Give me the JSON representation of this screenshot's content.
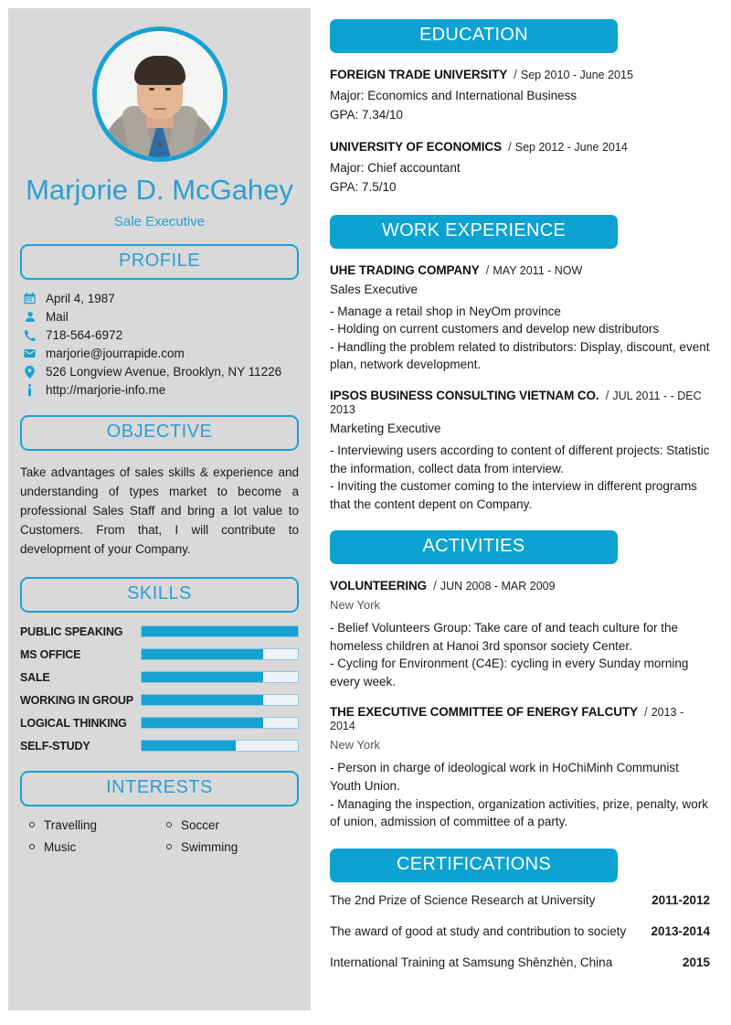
{
  "theme": {
    "accent": "#0ca3d2",
    "accent_border": "#17a2d4",
    "sidebar_bg": "#d9d9d9",
    "name_color": "#2b9ed4"
  },
  "sidebar": {
    "name": "Marjorie D. McGahey",
    "job_title": "Sale Executive",
    "profile_heading": "PROFILE",
    "contacts": [
      {
        "icon": "calendar-icon",
        "text": "April 4, 1987"
      },
      {
        "icon": "user-icon",
        "text": "Mail"
      },
      {
        "icon": "phone-icon",
        "text": "718-564-6972"
      },
      {
        "icon": "envelope-icon",
        "text": "marjorie@jourrapide.com"
      },
      {
        "icon": "map-pin-icon",
        "text": "526 Longview Avenue, Brooklyn, NY 11226"
      },
      {
        "icon": "info-icon",
        "text": "http://marjorie-info.me"
      }
    ],
    "objective_heading": "OBJECTIVE",
    "objective_text": "Take advantages of sales skills & experience and understanding of types market to become a professional Sales Staff and bring a lot value to Customers. From that, I will contribute to development of your Company.",
    "skills_heading": "SKILLS",
    "skills": [
      {
        "label": "PUBLIC SPEAKING",
        "value": 100
      },
      {
        "label": "MS OFFICE",
        "value": 78
      },
      {
        "label": "SALE",
        "value": 78
      },
      {
        "label": "WORKING IN GROUP",
        "value": 78
      },
      {
        "label": "LOGICAL THINKING",
        "value": 78
      },
      {
        "label": "SELF-STUDY",
        "value": 60
      }
    ],
    "interests_heading": "INTERESTS",
    "interests": [
      "Travelling",
      "Soccer",
      "Music",
      "Swimming"
    ]
  },
  "main": {
    "education": {
      "heading": "EDUCATION",
      "items": [
        {
          "org": "FOREIGN TRADE UNIVERSITY",
          "sep": "/",
          "date": "Sep 2010 - June 2015",
          "line1": "Major: Economics and International Business",
          "line2": "GPA: 7.34/10"
        },
        {
          "org": "UNIVERSITY OF ECONOMICS",
          "sep": "/",
          "date": "Sep 2012 - June 2014",
          "line1": "Major: Chief accountant",
          "line2": "GPA: 7.5/10"
        }
      ]
    },
    "work": {
      "heading": "WORK EXPERIENCE",
      "items": [
        {
          "org": "UHE TRADING COMPANY",
          "sep": "/",
          "date": "MAY 2011 - NOW",
          "role": "Sales Executive",
          "bullets": [
            "- Manage a retail shop in NeyOm province",
            "- Holding on current customers and develop new distributors",
            "- Handling the problem related to distributors: Display, discount, event plan, network development."
          ]
        },
        {
          "org": "IPSOS BUSINESS CONSULTING VIETNAM CO.",
          "sep": "/",
          "date": "JUL 2011 - - DEC 2013",
          "role": "Marketing Executive",
          "bullets": [
            "- Interviewing users according to content of different projects: Statistic the information, collect data from interview.",
            "- Inviting the customer coming to the interview in different programs that the content depent on Company."
          ]
        }
      ]
    },
    "activities": {
      "heading": "ACTIVITIES",
      "items": [
        {
          "org": "VOLUNTEERING",
          "sep": "/",
          "date": "JUN 2008 - MAR 2009",
          "place": "New York",
          "bullets": [
            "- Belief Volunteers Group: Take care of and teach culture for the homeless children at Hanoi 3rd sponsor society Center.",
            "- Cycling for Environment (C4E): cycling in every Sunday morning every week."
          ]
        },
        {
          "org": "THE EXECUTIVE COMMITTEE OF ENERGY FALCUTY",
          "sep": "/",
          "date": "2013 - 2014",
          "place": "New York",
          "bullets": [
            "- Person in charge of ideological work in HoChiMinh Communist Youth Union.",
            "- Managing the inspection, organization activities, prize, penalty, work of union, admission of committee of a party."
          ]
        }
      ]
    },
    "certifications": {
      "heading": "CERTIFICATIONS",
      "items": [
        {
          "title": "The 2nd Prize of Science Research at University",
          "year": "2011-2012"
        },
        {
          "title": "The award of good at study and contribution to society",
          "year": "2013-2014"
        },
        {
          "title": "International Training at Samsung Shēnzhèn, China",
          "year": "2015"
        }
      ]
    }
  }
}
